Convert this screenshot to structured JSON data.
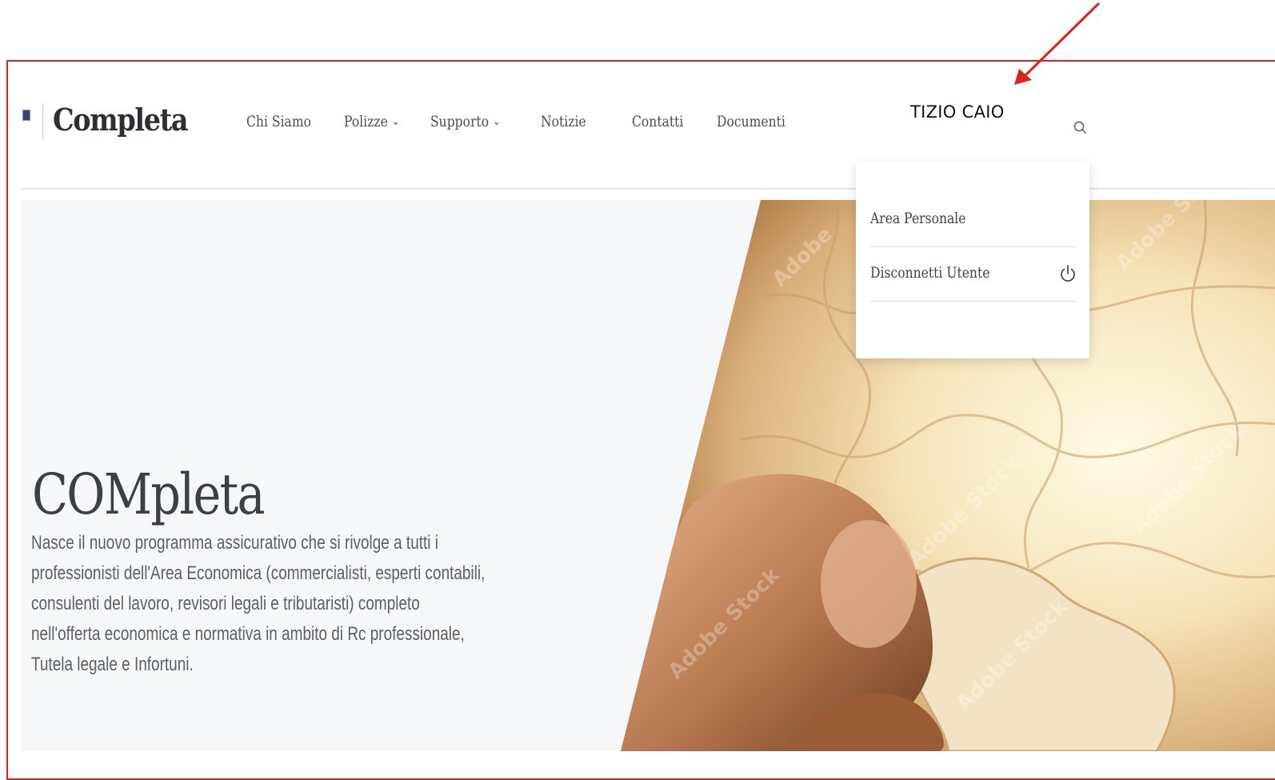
{
  "header": {
    "logo_text": "Completa",
    "nav": [
      {
        "label": "Chi Siamo",
        "has_dropdown": false
      },
      {
        "label": "Polizze",
        "has_dropdown": true
      },
      {
        "label": "Supporto",
        "has_dropdown": true
      },
      {
        "label": "Notizie",
        "has_dropdown": false
      },
      {
        "label": "Contatti",
        "has_dropdown": false
      },
      {
        "label": "Documenti",
        "has_dropdown": false
      }
    ],
    "user_name": "TIZIO CAIO",
    "search_icon": "search-icon"
  },
  "user_menu": {
    "items": [
      {
        "label": "Area Personale",
        "icon": ""
      },
      {
        "label": "Disconnetti Utente",
        "icon": "power-icon"
      }
    ]
  },
  "hero": {
    "title": "COMpleta",
    "text_lines": [
      "Nasce il nuovo programma assicurativo  che si rivolge a tutti i",
      "professionisti dell'Area Economica (commercialisti, esperti contabili,",
      "consulenti del lavoro, revisori legali e tributaristi) completo",
      "nell'offerta economica e normativa in ambito di Rc professionale,",
      "Tutela legale e Infortuni."
    ],
    "image_subject": "hand placing puzzle piece"
  },
  "annotation": {
    "frame_color": "#e0221e",
    "arrow_color": "#e0221e"
  },
  "colors": {
    "text_dark": "#2c2f34",
    "nav_text": "#4a4d52",
    "hero_bg": "#f6f7f9"
  }
}
